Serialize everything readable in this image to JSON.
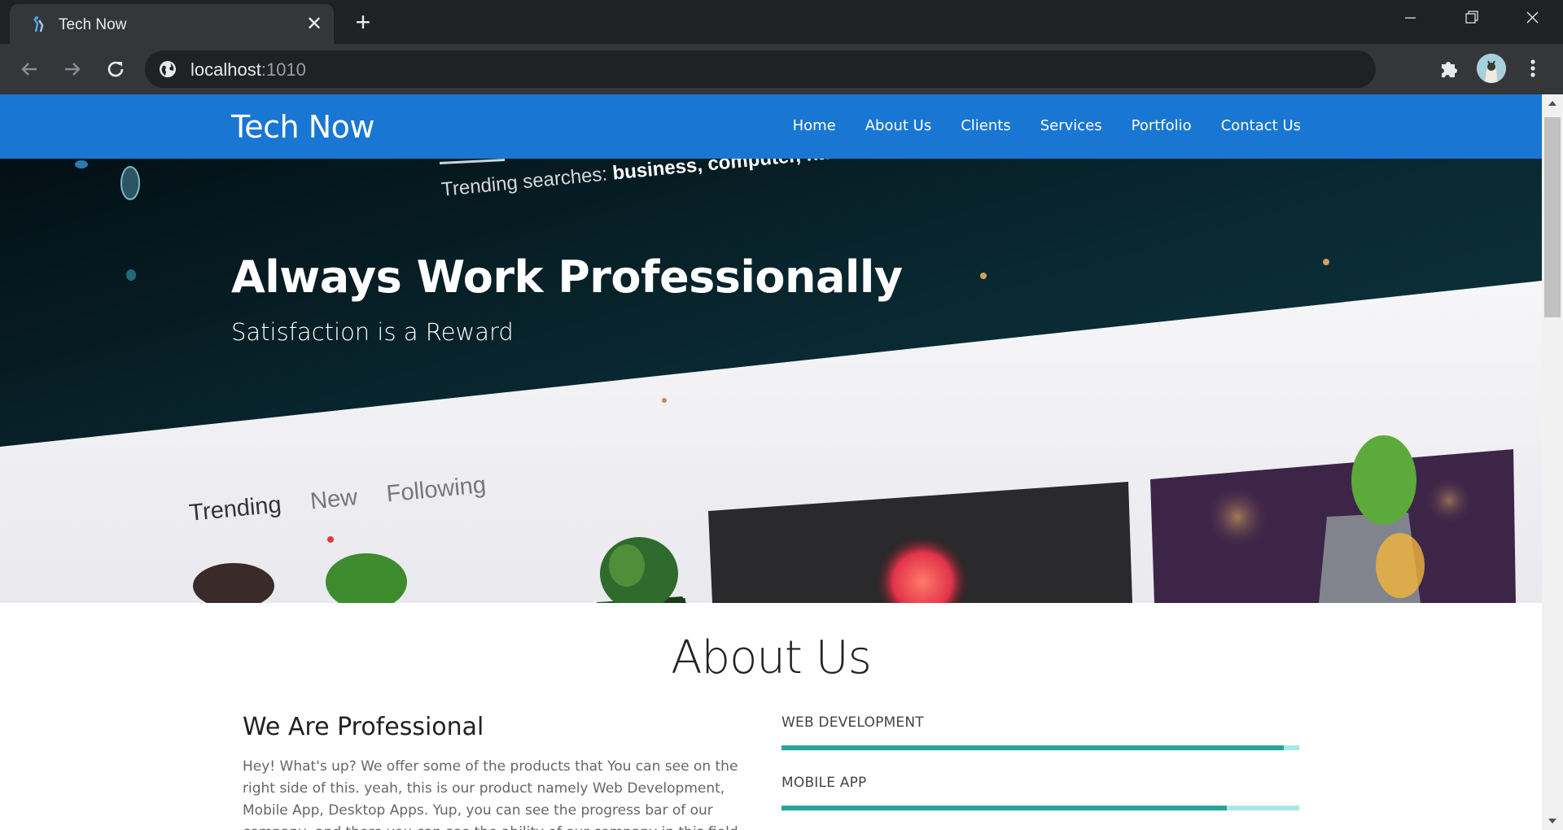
{
  "browser": {
    "tab_title": "Tech Now",
    "url_host": "localhost",
    "url_port": ":1010"
  },
  "navbar": {
    "brand": "Tech Now",
    "links": [
      "Home",
      "About Us",
      "Clients",
      "Services",
      "Portfolio",
      "Contact Us"
    ]
  },
  "hero": {
    "title": "Always Work Professionally",
    "subtitle": "Satisfaction is a Reward",
    "image_text": {
      "trending_label": "Trending searches:",
      "trending_terms": "business, computer, nature, love, house",
      "tabs": [
        "Trending",
        "New",
        "Following"
      ]
    }
  },
  "about": {
    "heading": "About Us",
    "subheading": "We Are Professional",
    "text": "Hey! What's up? We offer some of the products that You can see on the right side of this. yeah, this is our product namely Web Development, Mobile App, Desktop Apps. Yup, you can see the progress bar of our company, and there you can see the ability of our company in this field. Cheers and enjoy our services.",
    "skills": [
      {
        "label": "WEB DEVELOPMENT",
        "percent": 97
      },
      {
        "label": "MOBILE APP",
        "percent": 86
      }
    ]
  },
  "colors": {
    "navbar": "#1976d2",
    "progress_fill": "#26a69a",
    "progress_track": "#a6e8e6"
  }
}
